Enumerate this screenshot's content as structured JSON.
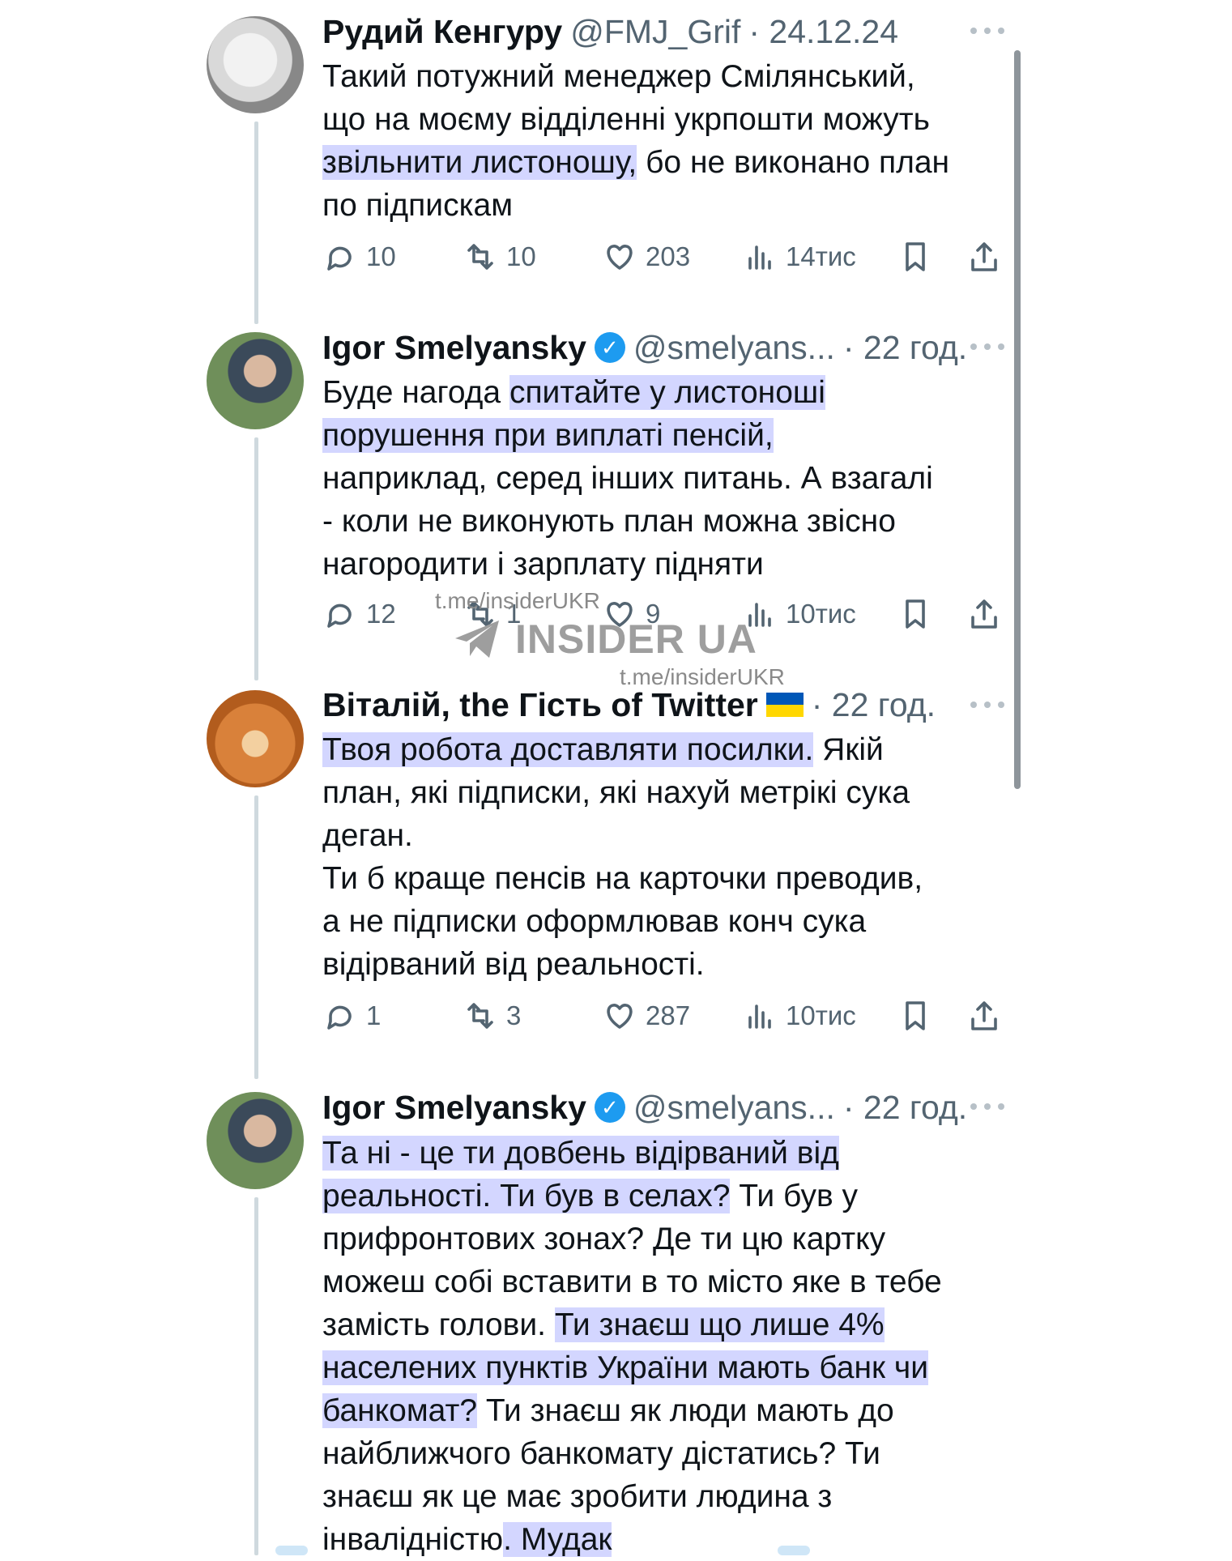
{
  "tweets": [
    {
      "name": "Рудий Кенгуру",
      "handle": "@FMJ_Grif",
      "time": "· 24.12.24",
      "verified": false,
      "avatar_icon": "avatar-icon",
      "lines": [
        [
          {
            "t": "Такий потужний менеджер Смілянський,",
            "h": false
          }
        ],
        [
          {
            "t": "що на моєму відділенні укрпошти можуть",
            "h": false
          }
        ],
        [
          {
            "t": "звільнити листоношу,",
            "h": true
          },
          {
            "t": " бо не виконано план",
            "h": false
          }
        ],
        [
          {
            "t": "по підпискам",
            "h": false
          }
        ]
      ],
      "stats": {
        "replies": "10",
        "retweets": "10",
        "likes": "203",
        "views": "14тис"
      }
    },
    {
      "name": "Igor Smelyansky",
      "handle": "@smelyans...",
      "time": "· 22 год.",
      "verified": true,
      "lines": [
        [
          {
            "t": "Буде нагода ",
            "h": false
          },
          {
            "t": "спитайте у листоноші",
            "h": true
          }
        ],
        [
          {
            "t": "порушення при виплаті пенсій,",
            "h": true
          }
        ],
        [
          {
            "t": "наприклад, серед інших питань. А взагалі",
            "h": false
          }
        ],
        [
          {
            "t": "- коли не виконують план можна звісно",
            "h": false
          }
        ],
        [
          {
            "t": "нагородити і зарплату підняти",
            "h": false
          }
        ]
      ],
      "stats": {
        "replies": "12",
        "retweets": "1",
        "likes": "9",
        "views": "10тис"
      }
    },
    {
      "name": "Віталій, the Гість of Twitter",
      "handle": "",
      "time": "· 22 год.",
      "verified": false,
      "flag": true,
      "lines": [
        [
          {
            "t": "Твоя робота доставляти посилки.",
            "h": true
          },
          {
            "t": " Якій",
            "h": false
          }
        ],
        [
          {
            "t": "план, які підписки, які нахуй метрікі сука",
            "h": false
          }
        ],
        [
          {
            "t": "деган.",
            "h": false
          }
        ],
        [
          {
            "t": "Ти б краще пенсів на карточки преводив,",
            "h": false
          }
        ],
        [
          {
            "t": "а не підписки оформлював конч сука",
            "h": false
          }
        ],
        [
          {
            "t": "відірваний від реальності.",
            "h": false
          }
        ]
      ],
      "stats": {
        "replies": "1",
        "retweets": "3",
        "likes": "287",
        "views": "10тис"
      }
    },
    {
      "name": "Igor Smelyansky",
      "handle": "@smelyans...",
      "time": "· 22 год.",
      "verified": true,
      "lines": [
        [
          {
            "t": "Та ні - це ти довбень відірваний від",
            "h": true
          }
        ],
        [
          {
            "t": "реальності. Ти був в селах?",
            "h": true
          },
          {
            "t": " Ти був у",
            "h": false
          }
        ],
        [
          {
            "t": "прифронтових зонах? Де ти цю картку",
            "h": false
          }
        ],
        [
          {
            "t": "можеш собі вставити в то місто яке в тебе",
            "h": false
          }
        ],
        [
          {
            "t": "замість голови. ",
            "h": false
          },
          {
            "t": "Ти знаєш що лише 4%",
            "h": true
          }
        ],
        [
          {
            "t": "населених пунктів України мають банк чи",
            "h": true
          }
        ],
        [
          {
            "t": "банкомат?",
            "h": true
          },
          {
            "t": " Ти знаєш як люди мають до",
            "h": false
          }
        ],
        [
          {
            "t": "найближчого банкомату дістатись? Ти",
            "h": false
          }
        ],
        [
          {
            "t": "знаєш як це має зробити людина з",
            "h": false
          }
        ],
        [
          {
            "t": "інвалідністю",
            "h": false
          },
          {
            "t": ". Мудак",
            "h": true
          }
        ]
      ]
    }
  ],
  "watermark": {
    "url_top": "t.me/insiderUKR",
    "brand": "INSIDER UA",
    "url_bottom": "t.me/insiderUKR"
  },
  "colors": {
    "highlight": "#d3d6ff",
    "verified": "#1d9bf0",
    "muted": "#536471"
  }
}
